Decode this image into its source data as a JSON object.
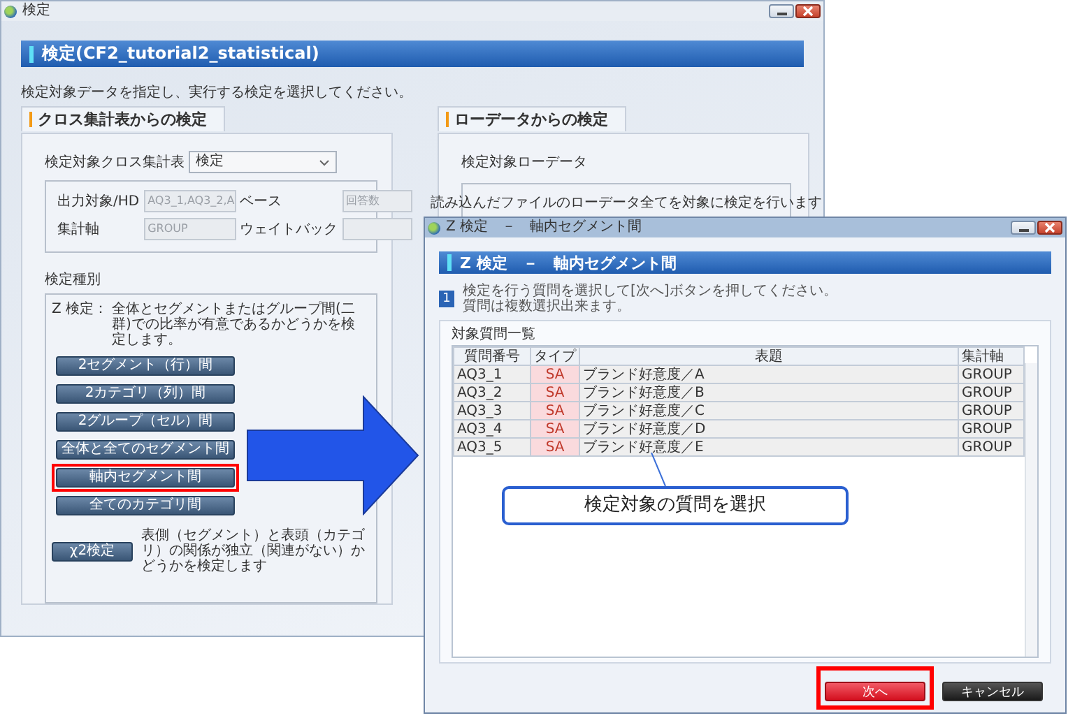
{
  "main_window": {
    "title": "検定",
    "header": "検定(CF2_tutorial2_statistical)",
    "instruction": "検定対象データを指定し、実行する検定を選択してください。",
    "cross_tab": {
      "tab": "クロス集計表からの検定",
      "dropdown_label": "検定対象クロス集計表",
      "dropdown_value": "検定",
      "fields": [
        {
          "label": "出力対象/HD",
          "value": "AQ3_1,AQ3_2,A",
          "disabled": true
        },
        {
          "label": "ベース",
          "value": "回答数",
          "disabled": true
        },
        {
          "label": "集計軸",
          "value": "GROUP",
          "disabled": true
        },
        {
          "label": "ウェイトバック",
          "disabled": true
        }
      ],
      "test_kind_label": "検定種別",
      "z_label": "Z 検定：",
      "z_description": "全体とセグメントまたはグループ間(二群)での比率が有意であるかどうかを検定します。",
      "z_buttons": [
        {
          "label": "2セグメント（行）間",
          "highlighted": false
        },
        {
          "label": "2カテゴリ（列）間",
          "highlighted": false
        },
        {
          "label": "2グループ（セル）間",
          "highlighted": false
        },
        {
          "label": "全体と全てのセグメント間",
          "highlighted": false
        },
        {
          "label": "軸内セグメント間",
          "highlighted": true
        },
        {
          "label": "全てのカテゴリ間",
          "highlighted": false
        }
      ],
      "chi_button": "χ2検定",
      "chi_description": "表側（セグメント）と表頭（カテゴリ）の関係が独立（関連がない）かどうかを検定します"
    },
    "raw_data": {
      "tab": "ローデータからの検定",
      "label": "検定対象ローデータ",
      "description": "読み込んだファイルのローデータ全てを対象に検定を行います"
    }
  },
  "dialog": {
    "title": "Z 検定　－　軸内セグメント間",
    "header": "Z 検定　－　軸内セグメント間",
    "step": "1",
    "step_lines": [
      "検定を行う質問を選択して[次へ]ボタンを押してください。",
      "質問は複数選択出来ます。"
    ],
    "list_label": "対象質問一覧",
    "columns": [
      "質問番号",
      "タイプ",
      "表題",
      "集計軸"
    ],
    "rows": [
      [
        "AQ3_1",
        "SA",
        "ブランド好意度／A",
        "GROUP"
      ],
      [
        "AQ3_2",
        "SA",
        "ブランド好意度／B",
        "GROUP"
      ],
      [
        "AQ3_3",
        "SA",
        "ブランド好意度／C",
        "GROUP"
      ],
      [
        "AQ3_4",
        "SA",
        "ブランド好意度／D",
        "GROUP"
      ],
      [
        "AQ3_5",
        "SA",
        "ブランド好意度／E",
        "GROUP"
      ]
    ],
    "buttons": [
      {
        "label": "次へ",
        "kind": "primary",
        "highlighted": true
      },
      {
        "label": "キャンセル",
        "kind": "secondary",
        "highlighted": false
      }
    ]
  },
  "callout": "検定対象の質問を選択"
}
